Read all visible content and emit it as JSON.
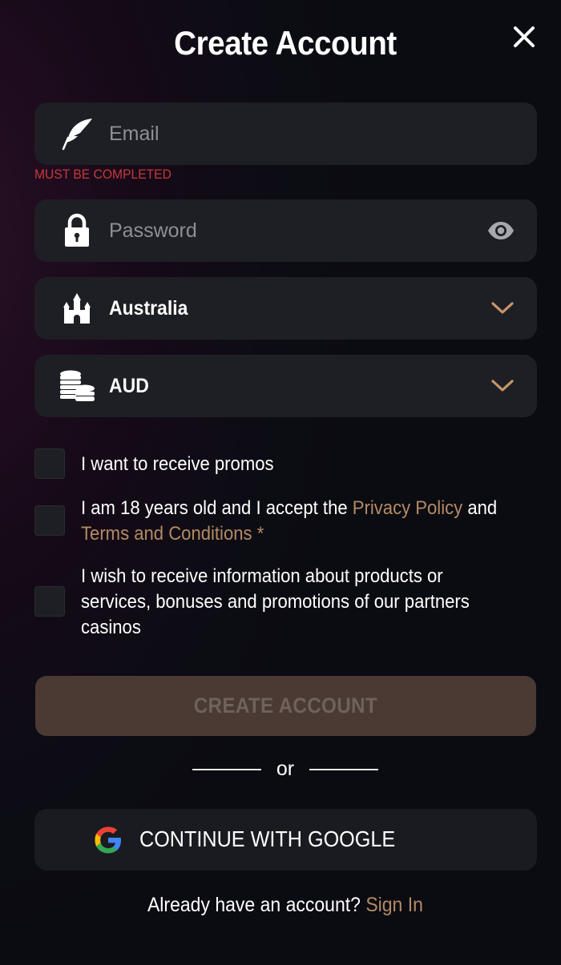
{
  "title": "Create Account",
  "close_icon": "close-icon",
  "email": {
    "placeholder": "Email",
    "value": "",
    "icon": "feather-icon",
    "error": "MUST BE COMPLETED"
  },
  "password": {
    "placeholder": "Password",
    "value": "",
    "icon": "lock-icon",
    "toggle_icon": "eye-icon"
  },
  "country": {
    "selected": "Australia",
    "icon": "castle-icon"
  },
  "currency": {
    "selected": "AUD",
    "icon": "coins-icon"
  },
  "checkboxes": {
    "promos": {
      "text": "I want to receive promos",
      "checked": false
    },
    "age": {
      "text_before": "I am 18 years old and I accept the ",
      "privacy_link": "Privacy Policy",
      "text_middle": " and ",
      "terms_link": "Terms and Conditions",
      "required_mark": " *",
      "checked": false
    },
    "partners": {
      "text": "I wish to receive information about products or services, bonuses and promotions of our partners casinos",
      "checked": false
    }
  },
  "create_button": "CREATE ACCOUNT",
  "or_text": "or",
  "google_button": "CONTINUE WITH GOOGLE",
  "signin": {
    "prompt": "Already have an account? ",
    "link": "Sign In"
  },
  "colors": {
    "accent": "#b48a63",
    "error": "#c8383a",
    "field_bg": "#1e1f24",
    "button_disabled_bg": "#4a3a33",
    "chevron": "#c8966a"
  }
}
